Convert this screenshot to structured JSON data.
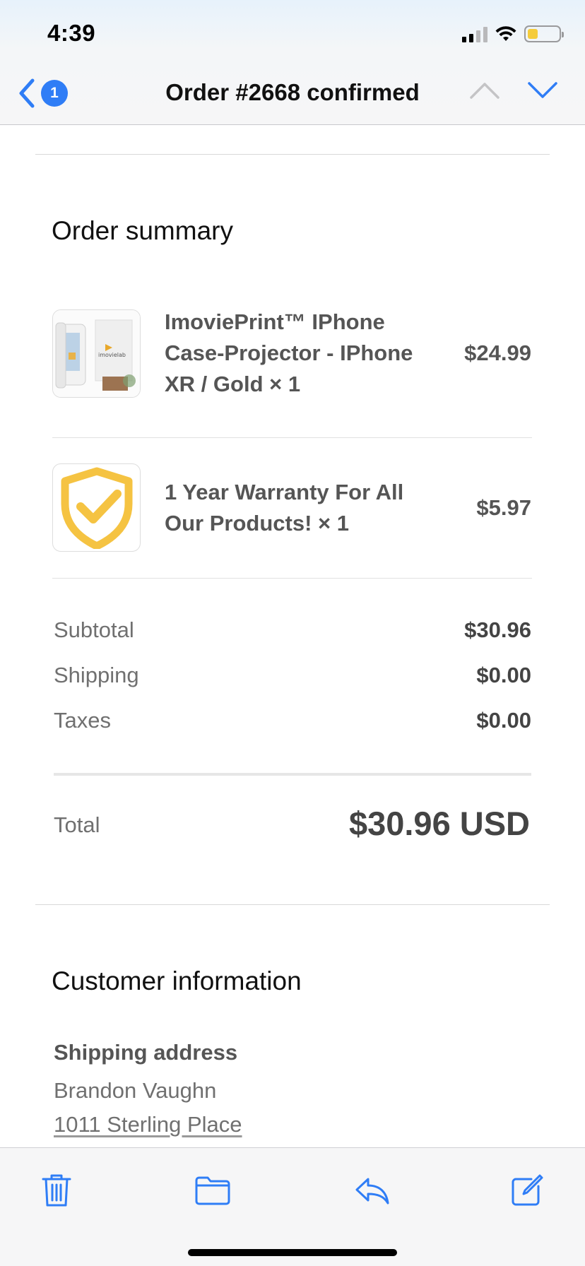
{
  "status_bar": {
    "time": "4:39"
  },
  "nav": {
    "unread_count": "1",
    "title": "Order #2668 confirmed"
  },
  "order_summary": {
    "heading": "Order summary",
    "items": [
      {
        "name": "ImoviePrint™ IPhone Case-Projector - IPhone XR / Gold × 1",
        "price": "$24.99",
        "thumb_logo_text": "imovielab"
      },
      {
        "name": "1 Year Warranty For All Our Products! × 1",
        "price": "$5.97"
      }
    ],
    "subtotal_label": "Subtotal",
    "subtotal_value": "$30.96",
    "shipping_label": "Shipping",
    "shipping_value": "$0.00",
    "taxes_label": "Taxes",
    "taxes_value": "$0.00",
    "total_label": "Total",
    "total_value": "$30.96 USD"
  },
  "customer_info": {
    "heading": "Customer information",
    "shipping_address_label": "Shipping address",
    "name": "Brandon Vaughn",
    "address_line1": "1011 Sterling Place"
  },
  "colors": {
    "accent_blue": "#2f7df6",
    "warranty_gold": "#f5c342",
    "battery_yellow": "#f5cc3b"
  },
  "icons": {
    "back": "chevron-left-icon",
    "prev": "chevron-up-icon",
    "next": "chevron-down-icon",
    "trash": "trash-icon",
    "folder": "folder-icon",
    "reply": "reply-icon",
    "compose": "compose-icon"
  }
}
